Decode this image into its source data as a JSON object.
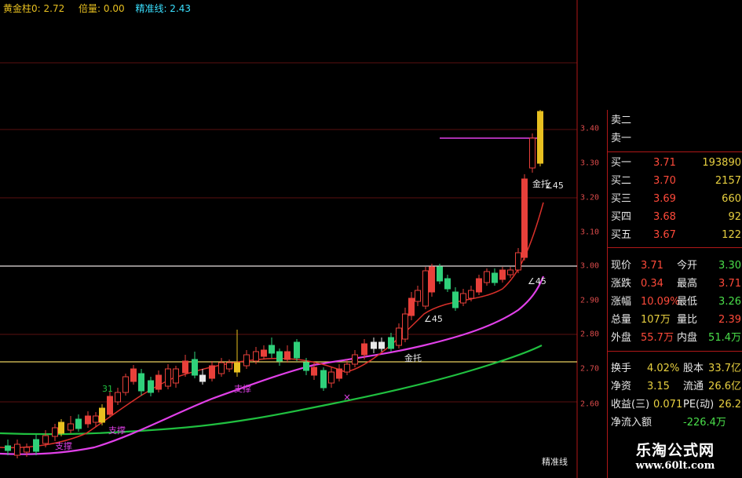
{
  "header": {
    "gold_label": "黄金柱0: 2.72",
    "volume_label": "倍量: 0.00",
    "precise_label": "精准线: 2.43"
  },
  "colors": {
    "bg": "#000000",
    "up": "#e8403a",
    "down": "#2fd07a",
    "ma_red": "#d8302a",
    "ma_magenta": "#e040e8",
    "ma_green": "#20c040",
    "gold": "#e8c020",
    "line_label": "#e8e8e8",
    "price_red": "#ff4a3a",
    "price_green": "#4adf4a",
    "text_white": "#e8e8e8"
  },
  "axis": {
    "ticks": [
      "3.40",
      "3.30",
      "3.20",
      "3.10",
      "3.00",
      "2.90",
      "2.80",
      "2.70",
      "2.60"
    ]
  },
  "annotations": {
    "support_1": "支撑",
    "support_2": "支撑",
    "support_3": "支撑",
    "cross_up": "金托",
    "cross_up_2": "金托",
    "angle_1": "∠45",
    "angle_2": "∠45",
    "angle_3": "∠45",
    "vol_31": "31",
    "precise_line": "精准线",
    "x_mark": "×"
  },
  "quote": {
    "sell": [
      {
        "label": "卖二",
        "price": "",
        "vol": ""
      },
      {
        "label": "卖一",
        "price": "",
        "vol": ""
      }
    ],
    "buy": [
      {
        "label": "买一",
        "price": "3.71",
        "vol": "193890"
      },
      {
        "label": "买二",
        "price": "3.70",
        "vol": "2157"
      },
      {
        "label": "买三",
        "price": "3.69",
        "vol": "660"
      },
      {
        "label": "买四",
        "price": "3.68",
        "vol": "92"
      },
      {
        "label": "买五",
        "price": "3.67",
        "vol": "122"
      }
    ],
    "stats": [
      {
        "l1": "现价",
        "v1": "3.71",
        "l2": "今开",
        "v2": "3.30"
      },
      {
        "l1": "涨跌",
        "v1": "0.34",
        "l2": "最高",
        "v2": "3.71"
      },
      {
        "l1": "涨幅",
        "v1": "10.09%",
        "l2": "最低",
        "v2": "3.26"
      },
      {
        "l1": "总量",
        "v1": "107万",
        "l2": "量比",
        "v2": "2.39"
      },
      {
        "l1": "外盘",
        "v1": "55.7万",
        "l2": "内盘",
        "v2": "51.4万"
      }
    ],
    "fund": [
      {
        "l1": "换手",
        "v1": "4.02%",
        "l2": "股本",
        "v2": "33.7亿"
      },
      {
        "l1": "净资",
        "v1": "3.15",
        "l2": "流通",
        "v2": "26.6亿"
      },
      {
        "l1": "收益(三)",
        "v1": "0.071",
        "l2": "PE(动)",
        "v2": "26.2"
      },
      {
        "l1": "净流入额",
        "v1": "-226.4万",
        "l2": "",
        "v2": ""
      }
    ]
  },
  "watermark": {
    "title": "乐淘公式网",
    "url": "www.60lt.com"
  }
}
